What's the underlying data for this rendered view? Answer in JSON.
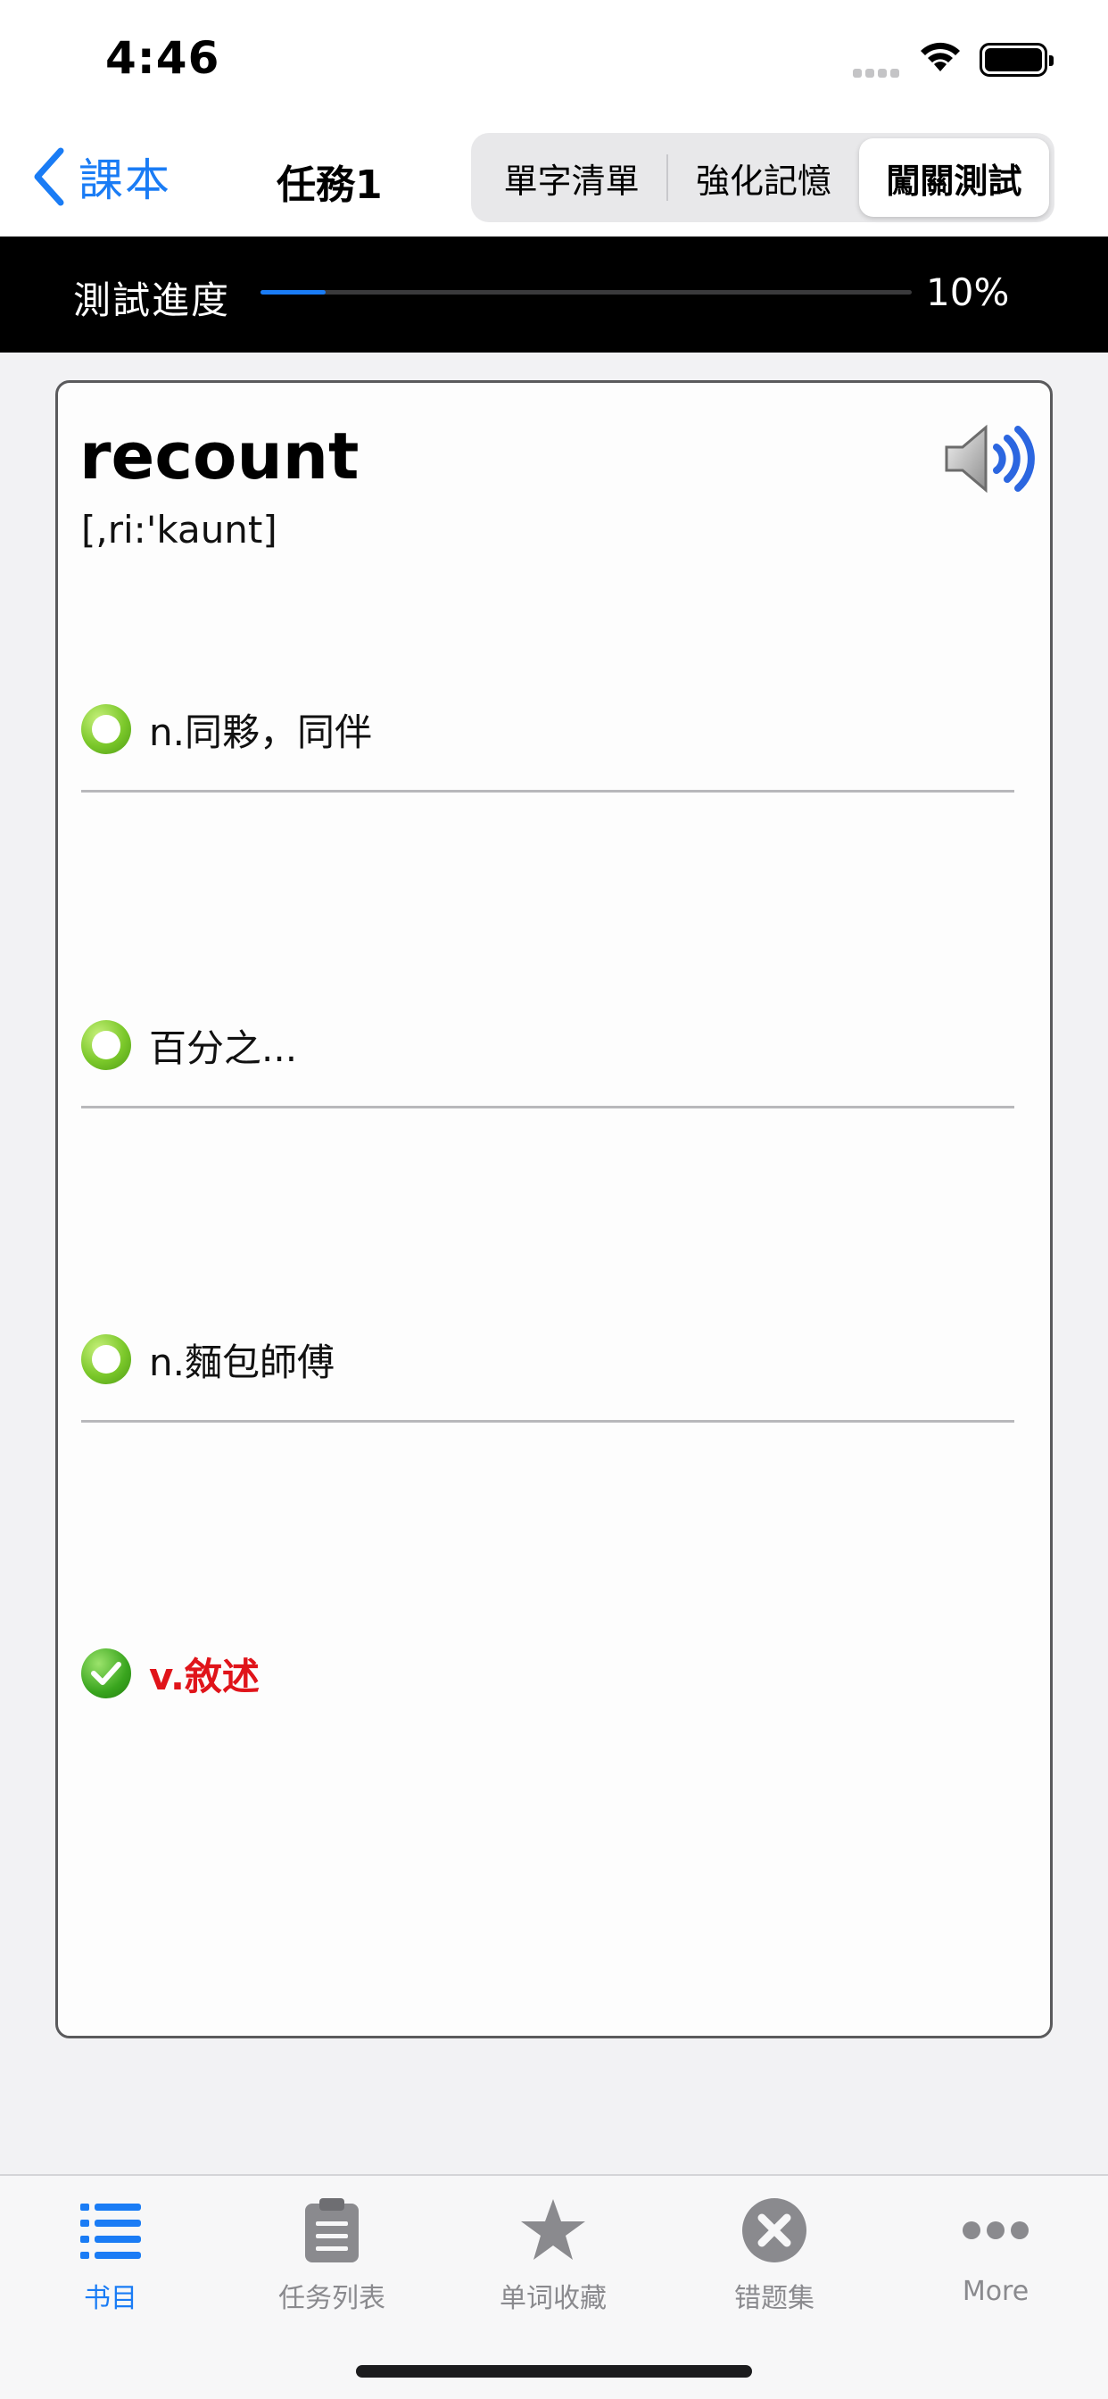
{
  "status_bar": {
    "time": "4:46"
  },
  "nav": {
    "back_label": "課本",
    "title": "任務1",
    "segments": [
      "單字清單",
      "強化記憶",
      "闖關測試"
    ],
    "selected_segment": "闖關測試"
  },
  "progress": {
    "label": "測試進度",
    "value_text": "10%",
    "fraction": 0.1
  },
  "card": {
    "word": "recount",
    "phonetic": "[,ri:'kaunt]",
    "speaker_icon": "speaker-icon",
    "options": [
      {
        "text": "n.同夥，同伴",
        "state": "unchecked"
      },
      {
        "text": "百分之...",
        "state": "unchecked"
      },
      {
        "text": "n.麵包師傅",
        "state": "unchecked"
      },
      {
        "text": "v.敘述",
        "state": "correct"
      }
    ]
  },
  "colors": {
    "accent": "#1a7cf5",
    "correct": "#e0141a",
    "radio_green": "#7bc82a"
  },
  "tab_bar": {
    "tabs": [
      {
        "label": "书目",
        "icon": "list-icon",
        "active": true
      },
      {
        "label": "任务列表",
        "icon": "clipboard-icon",
        "active": false
      },
      {
        "label": "单词收藏",
        "icon": "star-icon",
        "active": false
      },
      {
        "label": "错题集",
        "icon": "x-circle-icon",
        "active": false
      },
      {
        "label": "More",
        "icon": "more-dots-icon",
        "active": false
      }
    ]
  }
}
